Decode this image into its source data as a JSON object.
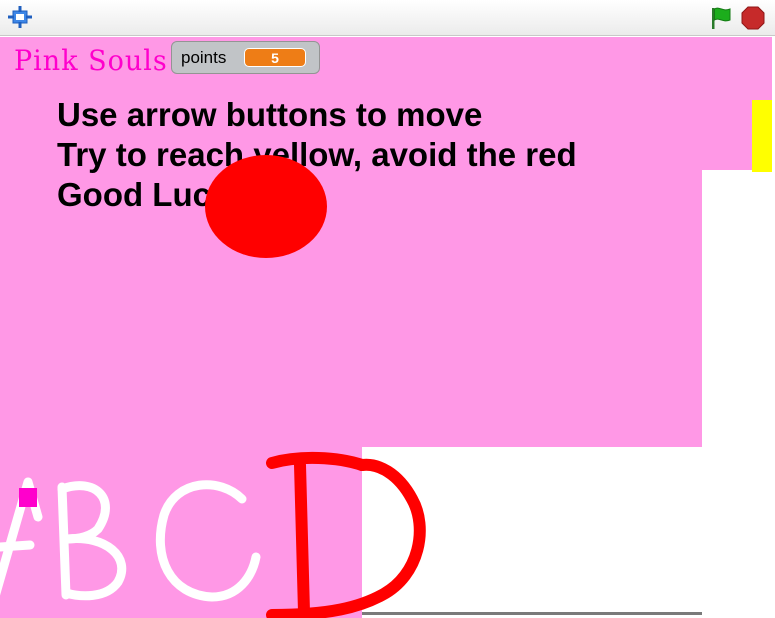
{
  "toolbar": {
    "fullscreen_icon": "fullscreen-icon",
    "green_flag_icon": "green-flag-icon",
    "stop_icon": "stop-sign-icon",
    "colors": {
      "green_flag": "#16a116",
      "stop": "#c62a2a",
      "fullscreen": "#2b6fd6"
    }
  },
  "stage": {
    "background_color": "#ff98e6",
    "title": "Pink Souls",
    "title_color": "#ff00cc",
    "points_monitor": {
      "label": "points",
      "value": "5",
      "value_color": "#ee7d16"
    },
    "instructions": [
      "Use arrow buttons to move",
      "Try to reach yellow, avoid the red",
      "Good Luck"
    ],
    "goal_color": "#ffff00",
    "enemy_color": "#ff0000",
    "player_color": "#ff00cc",
    "letters": [
      "A",
      "B",
      "C",
      "D"
    ],
    "letter_colors": {
      "A": "#ffffff",
      "B": "#ffffff",
      "C": "#ffffff",
      "D": "#ff0000"
    }
  }
}
